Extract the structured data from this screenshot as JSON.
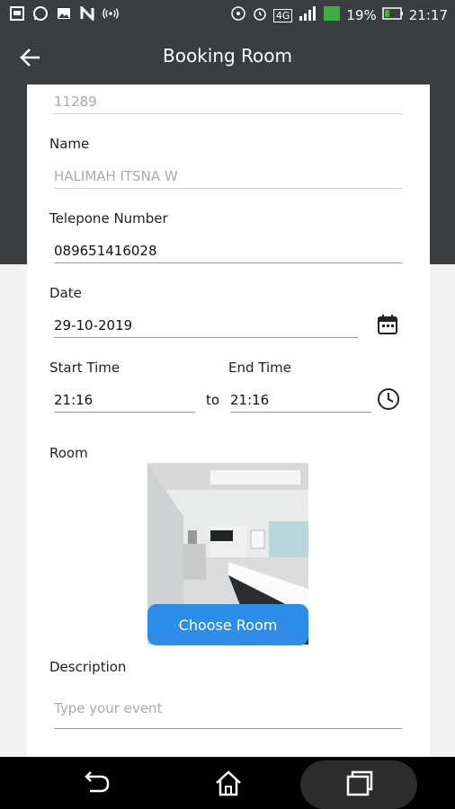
{
  "status_bar": {
    "left_icons": [
      "gallery-icon",
      "whatsapp-icon",
      "image-icon",
      "n-icon",
      "broadcast-icon"
    ],
    "right_icons": [
      "hotspot-icon",
      "alarm-icon",
      "4g-icon",
      "signal-icon",
      "battery-icon"
    ],
    "network": "4G",
    "battery": "19%",
    "time": "21:17"
  },
  "app_bar": {
    "title": "Booking Room",
    "back_icon": "arrow-left-icon"
  },
  "form": {
    "id_value": "11289",
    "name": {
      "label": "Name",
      "value": "HALIMAH ITSNA W"
    },
    "phone": {
      "label": "Telepone Number",
      "value": "089651416028"
    },
    "date": {
      "label": "Date",
      "value": "29-10-2019",
      "icon": "calendar-icon"
    },
    "start_time": {
      "label": "Start Time",
      "value": "21:16"
    },
    "end_time": {
      "label": "End Time",
      "value": "21:16",
      "icon": "clock-icon"
    },
    "to_label": "to",
    "room": {
      "label": "Room",
      "button": "Choose Room"
    },
    "description": {
      "label": "Description",
      "placeholder": "Type your event"
    }
  },
  "nav_bar": {
    "icons": [
      "back-nav-icon",
      "home-nav-icon",
      "recents-nav-icon"
    ]
  },
  "colors": {
    "header": "#3b3e40",
    "accent": "#2e8de8"
  }
}
